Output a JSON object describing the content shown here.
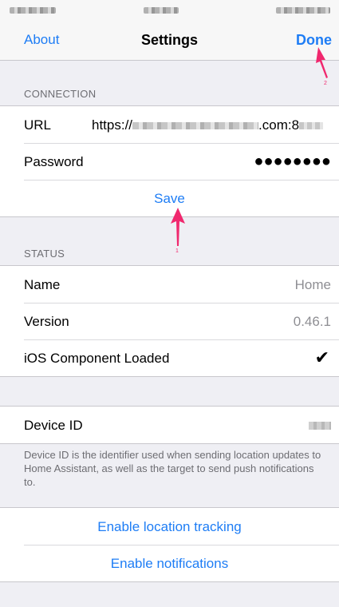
{
  "nav": {
    "left": "About",
    "title": "Settings",
    "right": "Done"
  },
  "connection": {
    "header": "CONNECTION",
    "url_label": "URL",
    "url_prefix": "https://",
    "url_suffix": ".com:8",
    "password_label": "Password",
    "password_value": "●●●●●●●●",
    "save": "Save"
  },
  "status": {
    "header": "STATUS",
    "name_label": "Name",
    "name_value": "Home",
    "version_label": "Version",
    "version_value": "0.46.1",
    "ios_label": "iOS Component Loaded",
    "ios_check": "✔"
  },
  "device": {
    "label": "Device ID",
    "note": "Device ID is the identifier used when sending location updates to Home Assistant, as well as the target to send push notifications to."
  },
  "actions": {
    "location": "Enable location tracking",
    "notifications": "Enable notifications"
  },
  "annotations": {
    "arrow1": "1",
    "arrow2": "2"
  },
  "colors": {
    "accent": "#1e7df5",
    "annotation": "#f0286e",
    "background": "#efeff4"
  }
}
